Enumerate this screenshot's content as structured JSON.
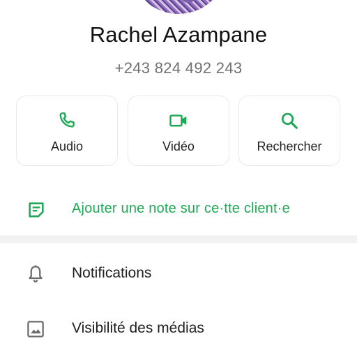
{
  "contact": {
    "name": "Rachel Azampane",
    "phone": "+243 824 492 243"
  },
  "actions": [
    {
      "label": "Audio",
      "icon": "phone-icon"
    },
    {
      "label": "Vidéo",
      "icon": "video-camera-icon"
    },
    {
      "label": "Rechercher",
      "icon": "search-icon"
    }
  ],
  "note": {
    "label": "Ajouter une note sur ce·tte client·e",
    "icon": "note-icon"
  },
  "menu": [
    {
      "label": "Notifications",
      "icon": "bell-icon"
    },
    {
      "label": "Visibilité des médias",
      "icon": "image-icon"
    }
  ],
  "colors": {
    "accent": "#1fa855",
    "icon_gray": "#6b6b6b",
    "secondary_text": "#707070"
  }
}
